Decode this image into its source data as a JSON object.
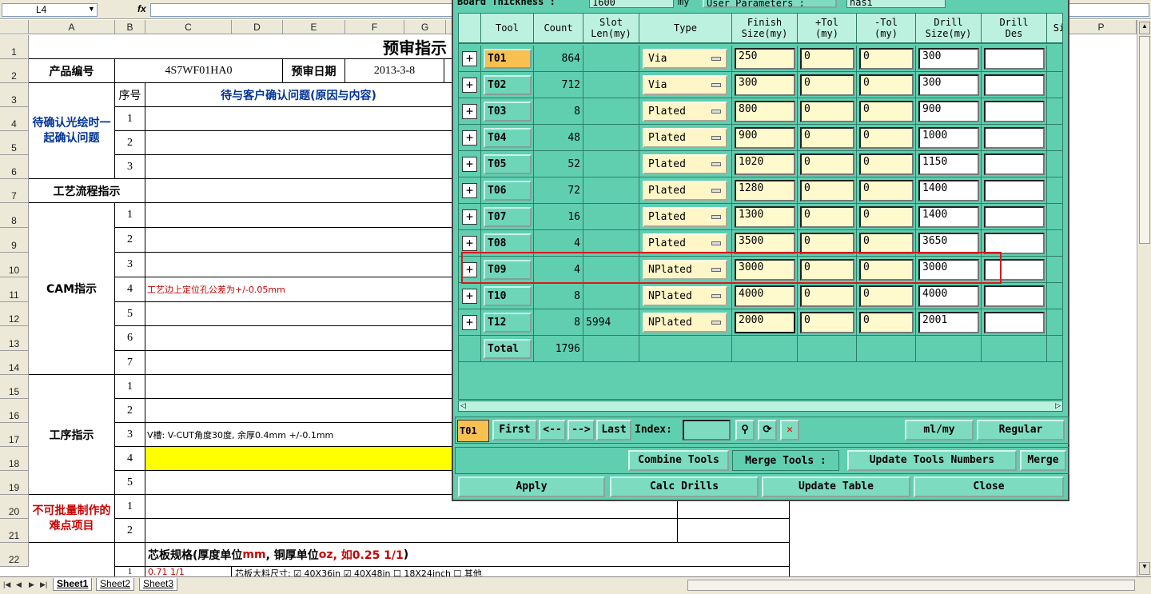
{
  "formula_bar": {
    "name_box": "L4",
    "fx": "fx"
  },
  "columns": [
    "A",
    "B",
    "C",
    "D",
    "E",
    "F",
    "G",
    "P"
  ],
  "rows": [
    "1",
    "2",
    "3",
    "4",
    "5",
    "6",
    "7",
    "8",
    "9",
    "10",
    "11",
    "12",
    "13",
    "14",
    "15",
    "16",
    "17",
    "18",
    "19",
    "20",
    "21",
    "22"
  ],
  "sheet": {
    "title": "预审指示",
    "product_label": "产品编号",
    "product_value": "4S7WF01HA0",
    "date_label": "预审日期",
    "date_value": "2013-3-8",
    "seq_header": "序号",
    "pending_header": "待与客户确认问题(原因与内容)",
    "confirm_label": "待确认光绘时一起确认问题",
    "process_flow": "工艺流程指示",
    "cam_label": "CAM指示",
    "cam_note": "工艺边上定位孔公差为+/-0.05mm",
    "proc_label": "工序指示",
    "proc_note": "V槽: V-CUT角度30度, 余厚0.4mm +/-0.1mm",
    "difficult_label": "不可批量制作的难点项目",
    "core_spec_a": "芯板规格(厚度单位",
    "core_spec_b": "mm",
    "core_spec_c": ", 铜厚单位",
    "core_spec_d": "oz",
    "core_spec_e": ", 如0.25 1/1",
    "core_spec_f": ")",
    "row23_partial": "0.71 1/1",
    "row23_text": "芯板大料尺寸: ☑ 40X36in  ☑ 40X48in  ☐ 18X24inch   ☐ 其他"
  },
  "tabs": [
    "Sheet1",
    "Sheet2",
    "Sheet3"
  ],
  "dialog": {
    "top_label1": "Board Thickness :",
    "top_value1": "1600",
    "top_unit": "my",
    "top_label2": "User Parameters :",
    "top_value2": "nasi",
    "headers": {
      "tool": "Tool",
      "count": "Count",
      "slot": "Slot\nLen(my)",
      "type": "Type",
      "finish": "Finish\nSize(my)",
      "ptol": "+Tol\n(my)",
      "ntol": "-Tol\n(my)",
      "drill": "Drill\nSize(my)",
      "des": "Drill\nDes",
      "si": "Si"
    },
    "rows": [
      {
        "tool": "T01",
        "count": "864",
        "slot": "",
        "type": "Via",
        "finish": "250",
        "ptol": "0",
        "ntol": "0",
        "drill": "300",
        "des": ""
      },
      {
        "tool": "T02",
        "count": "712",
        "slot": "",
        "type": "Via",
        "finish": "300",
        "ptol": "0",
        "ntol": "0",
        "drill": "300",
        "des": ""
      },
      {
        "tool": "T03",
        "count": "8",
        "slot": "",
        "type": "Plated",
        "finish": "800",
        "ptol": "0",
        "ntol": "0",
        "drill": "900",
        "des": ""
      },
      {
        "tool": "T04",
        "count": "48",
        "slot": "",
        "type": "Plated",
        "finish": "900",
        "ptol": "0",
        "ntol": "0",
        "drill": "1000",
        "des": ""
      },
      {
        "tool": "T05",
        "count": "52",
        "slot": "",
        "type": "Plated",
        "finish": "1020",
        "ptol": "0",
        "ntol": "0",
        "drill": "1150",
        "des": ""
      },
      {
        "tool": "T06",
        "count": "72",
        "slot": "",
        "type": "Plated",
        "finish": "1280",
        "ptol": "0",
        "ntol": "0",
        "drill": "1400",
        "des": ""
      },
      {
        "tool": "T07",
        "count": "16",
        "slot": "",
        "type": "Plated",
        "finish": "1300",
        "ptol": "0",
        "ntol": "0",
        "drill": "1400",
        "des": ""
      },
      {
        "tool": "T08",
        "count": "4",
        "slot": "",
        "type": "Plated",
        "finish": "3500",
        "ptol": "0",
        "ntol": "0",
        "drill": "3650",
        "des": ""
      },
      {
        "tool": "T09",
        "count": "4",
        "slot": "",
        "type": "NPlated",
        "finish": "3000",
        "ptol": "0",
        "ntol": "0",
        "drill": "3000",
        "des": ""
      },
      {
        "tool": "T10",
        "count": "8",
        "slot": "",
        "type": "NPlated",
        "finish": "4000",
        "ptol": "0",
        "ntol": "0",
        "drill": "4000",
        "des": ""
      },
      {
        "tool": "T12",
        "count": "8",
        "slot": "5994",
        "type": "NPlated",
        "finish": "2000",
        "ptol": "0",
        "ntol": "0",
        "drill": "2001",
        "des": ""
      }
    ],
    "total_label": "Total",
    "total_count": "1796",
    "current_tool": "T01",
    "nav": {
      "first": "First",
      "prev": "<--",
      "next": "-->",
      "last": "Last",
      "index": "Index:"
    },
    "units": "ml/my",
    "mode": "Regular",
    "combine": "Combine Tools",
    "merge_label": "Merge Tools :",
    "update_numbers": "Update Tools Numbers",
    "merge": "Merge",
    "apply": "Apply",
    "calc": "Calc Drills",
    "update_table": "Update Table",
    "close": "Close"
  },
  "colors": {
    "dialog_bg": "#5fcfb0",
    "selected_tool": "#f8c050",
    "highlight": "#d6181c",
    "yellow_cell": "#ffff00"
  }
}
